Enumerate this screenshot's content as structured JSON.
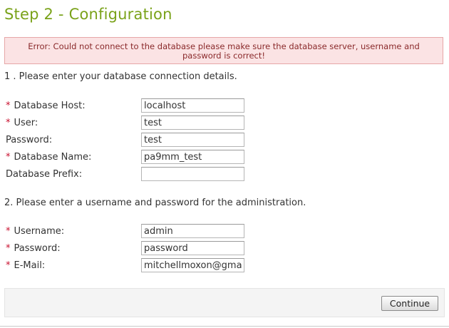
{
  "page": {
    "title": "Step 2 - Configuration"
  },
  "error": {
    "message": "Error: Could not connect to the database please make sure the database server, username and password is correct!"
  },
  "database_section": {
    "heading": "1 . Please enter your database connection details.",
    "fields": {
      "host": {
        "label": "Database Host:",
        "required": true,
        "value": "localhost"
      },
      "user": {
        "label": "User:",
        "required": true,
        "value": "test"
      },
      "password": {
        "label": "Password:",
        "required": false,
        "value": "test"
      },
      "name": {
        "label": "Database Name:",
        "required": true,
        "value": "pa9mm_test"
      },
      "prefix": {
        "label": "Database Prefix:",
        "required": false,
        "value": ""
      }
    }
  },
  "admin_section": {
    "heading": "2. Please enter a username and password for the administration.",
    "fields": {
      "username": {
        "label": "Username:",
        "required": true,
        "value": "admin"
      },
      "password": {
        "label": "Password:",
        "required": true,
        "value": "password"
      },
      "email": {
        "label": "E-Mail:",
        "required": true,
        "value": "mitchellmoxon@gmail."
      }
    }
  },
  "required_marker": "*",
  "footer": {
    "continue_label": "Continue"
  },
  "colors": {
    "title": "#7aa21a",
    "error_background": "#fbe3e4",
    "error_border": "#e6a7a8",
    "error_text": "#8a2a2b",
    "required_marker": "#c8102e"
  }
}
